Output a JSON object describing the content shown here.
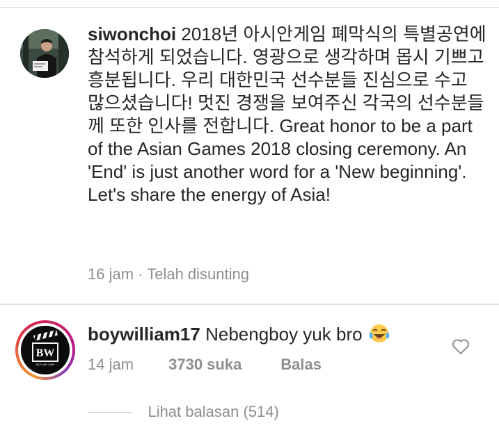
{
  "caption": {
    "username": "siwonchoi",
    "text": "2018년 아시안게임 폐막식의 특별공연에 참석하게 되었습니다. 영광으로 생각하며 몹시 기쁘고 흥분됩니다. 우리 대한민국 선수분들 진심으로 수고 많으셨습니다! 멋진 경쟁을 보여주신 각국의 선수분들께 또한 인사를 전합니다. Great honor to be a part of the Asian Games 2018 closing ceremony. An 'End' is just another word for a 'New beginning'. Let's share the energy of Asia!",
    "time": "16 jam",
    "separator": "·",
    "edited": "Telah disunting",
    "avatar_icon": "profile-photo"
  },
  "comment": {
    "username": "boywilliam17",
    "text": "Nebengboy yuk bro",
    "emoji_icon": "face-with-tears-of-joy-icon",
    "time": "14 jam",
    "likes": "3730 suka",
    "reply": "Balas",
    "avatar_icon": "bw-logo",
    "avatar_letters": "BW",
    "avatar_sub": "BOY WILLIAM"
  },
  "replies": {
    "label": "Lihat balasan (514)"
  },
  "colors": {
    "text": "#262626",
    "muted": "#8e8e8e",
    "divider": "#e0e0e0",
    "story_ring": "#dc2743"
  }
}
